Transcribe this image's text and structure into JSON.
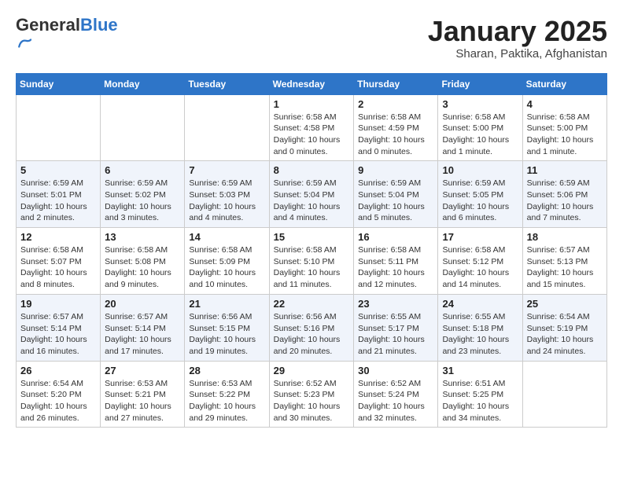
{
  "header": {
    "logo_general": "General",
    "logo_blue": "Blue",
    "title": "January 2025",
    "subtitle": "Sharan, Paktika, Afghanistan"
  },
  "weekdays": [
    "Sunday",
    "Monday",
    "Tuesday",
    "Wednesday",
    "Thursday",
    "Friday",
    "Saturday"
  ],
  "weeks": [
    [
      {
        "day": "",
        "info": ""
      },
      {
        "day": "",
        "info": ""
      },
      {
        "day": "",
        "info": ""
      },
      {
        "day": "1",
        "info": "Sunrise: 6:58 AM\nSunset: 4:58 PM\nDaylight: 10 hours\nand 0 minutes."
      },
      {
        "day": "2",
        "info": "Sunrise: 6:58 AM\nSunset: 4:59 PM\nDaylight: 10 hours\nand 0 minutes."
      },
      {
        "day": "3",
        "info": "Sunrise: 6:58 AM\nSunset: 5:00 PM\nDaylight: 10 hours\nand 1 minute."
      },
      {
        "day": "4",
        "info": "Sunrise: 6:58 AM\nSunset: 5:00 PM\nDaylight: 10 hours\nand 1 minute."
      }
    ],
    [
      {
        "day": "5",
        "info": "Sunrise: 6:59 AM\nSunset: 5:01 PM\nDaylight: 10 hours\nand 2 minutes."
      },
      {
        "day": "6",
        "info": "Sunrise: 6:59 AM\nSunset: 5:02 PM\nDaylight: 10 hours\nand 3 minutes."
      },
      {
        "day": "7",
        "info": "Sunrise: 6:59 AM\nSunset: 5:03 PM\nDaylight: 10 hours\nand 4 minutes."
      },
      {
        "day": "8",
        "info": "Sunrise: 6:59 AM\nSunset: 5:04 PM\nDaylight: 10 hours\nand 4 minutes."
      },
      {
        "day": "9",
        "info": "Sunrise: 6:59 AM\nSunset: 5:04 PM\nDaylight: 10 hours\nand 5 minutes."
      },
      {
        "day": "10",
        "info": "Sunrise: 6:59 AM\nSunset: 5:05 PM\nDaylight: 10 hours\nand 6 minutes."
      },
      {
        "day": "11",
        "info": "Sunrise: 6:59 AM\nSunset: 5:06 PM\nDaylight: 10 hours\nand 7 minutes."
      }
    ],
    [
      {
        "day": "12",
        "info": "Sunrise: 6:58 AM\nSunset: 5:07 PM\nDaylight: 10 hours\nand 8 minutes."
      },
      {
        "day": "13",
        "info": "Sunrise: 6:58 AM\nSunset: 5:08 PM\nDaylight: 10 hours\nand 9 minutes."
      },
      {
        "day": "14",
        "info": "Sunrise: 6:58 AM\nSunset: 5:09 PM\nDaylight: 10 hours\nand 10 minutes."
      },
      {
        "day": "15",
        "info": "Sunrise: 6:58 AM\nSunset: 5:10 PM\nDaylight: 10 hours\nand 11 minutes."
      },
      {
        "day": "16",
        "info": "Sunrise: 6:58 AM\nSunset: 5:11 PM\nDaylight: 10 hours\nand 12 minutes."
      },
      {
        "day": "17",
        "info": "Sunrise: 6:58 AM\nSunset: 5:12 PM\nDaylight: 10 hours\nand 14 minutes."
      },
      {
        "day": "18",
        "info": "Sunrise: 6:57 AM\nSunset: 5:13 PM\nDaylight: 10 hours\nand 15 minutes."
      }
    ],
    [
      {
        "day": "19",
        "info": "Sunrise: 6:57 AM\nSunset: 5:14 PM\nDaylight: 10 hours\nand 16 minutes."
      },
      {
        "day": "20",
        "info": "Sunrise: 6:57 AM\nSunset: 5:14 PM\nDaylight: 10 hours\nand 17 minutes."
      },
      {
        "day": "21",
        "info": "Sunrise: 6:56 AM\nSunset: 5:15 PM\nDaylight: 10 hours\nand 19 minutes."
      },
      {
        "day": "22",
        "info": "Sunrise: 6:56 AM\nSunset: 5:16 PM\nDaylight: 10 hours\nand 20 minutes."
      },
      {
        "day": "23",
        "info": "Sunrise: 6:55 AM\nSunset: 5:17 PM\nDaylight: 10 hours\nand 21 minutes."
      },
      {
        "day": "24",
        "info": "Sunrise: 6:55 AM\nSunset: 5:18 PM\nDaylight: 10 hours\nand 23 minutes."
      },
      {
        "day": "25",
        "info": "Sunrise: 6:54 AM\nSunset: 5:19 PM\nDaylight: 10 hours\nand 24 minutes."
      }
    ],
    [
      {
        "day": "26",
        "info": "Sunrise: 6:54 AM\nSunset: 5:20 PM\nDaylight: 10 hours\nand 26 minutes."
      },
      {
        "day": "27",
        "info": "Sunrise: 6:53 AM\nSunset: 5:21 PM\nDaylight: 10 hours\nand 27 minutes."
      },
      {
        "day": "28",
        "info": "Sunrise: 6:53 AM\nSunset: 5:22 PM\nDaylight: 10 hours\nand 29 minutes."
      },
      {
        "day": "29",
        "info": "Sunrise: 6:52 AM\nSunset: 5:23 PM\nDaylight: 10 hours\nand 30 minutes."
      },
      {
        "day": "30",
        "info": "Sunrise: 6:52 AM\nSunset: 5:24 PM\nDaylight: 10 hours\nand 32 minutes."
      },
      {
        "day": "31",
        "info": "Sunrise: 6:51 AM\nSunset: 5:25 PM\nDaylight: 10 hours\nand 34 minutes."
      },
      {
        "day": "",
        "info": ""
      }
    ]
  ]
}
